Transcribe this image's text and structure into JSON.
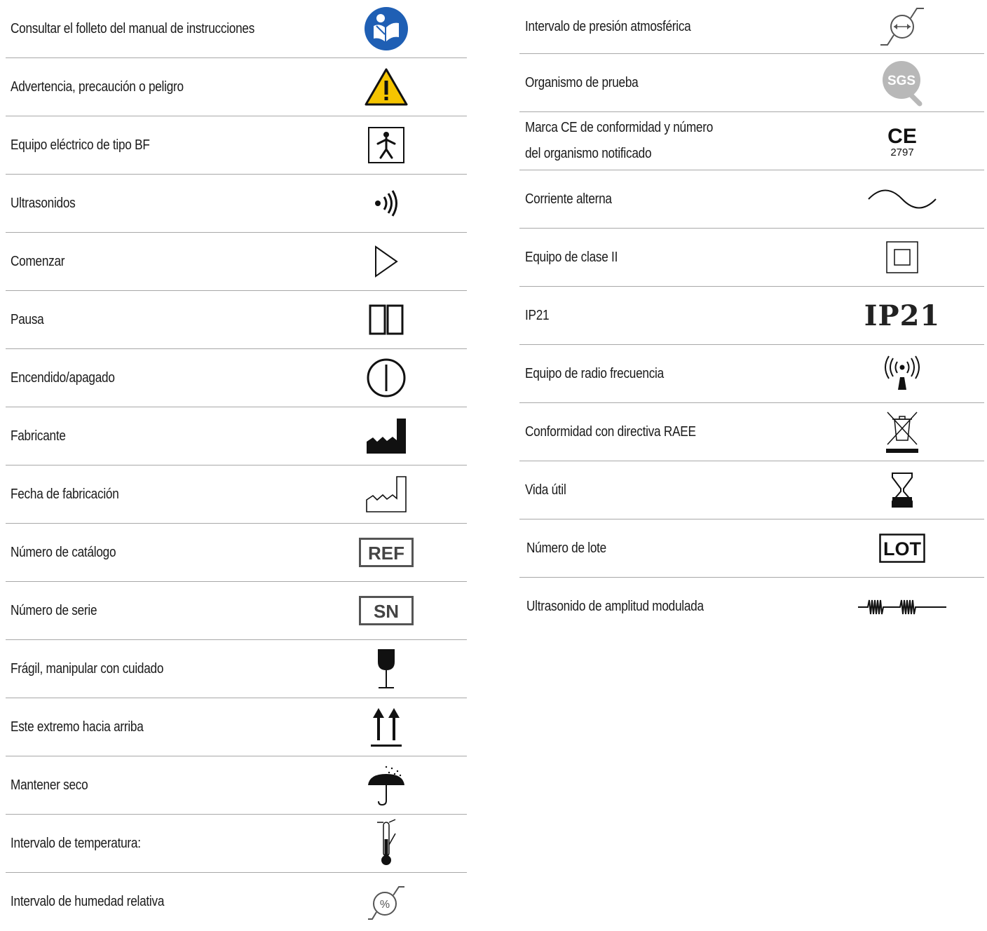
{
  "left_rows": [
    {
      "label": "Consultar el folleto del manual de instrucciones",
      "icon": "instruction-manual-icon"
    },
    {
      "label": "Advertencia, precaución o peligro",
      "icon": "warning-triangle-icon"
    },
    {
      "label": "Equipo eléctrico de tipo BF",
      "icon": "type-bf-icon"
    },
    {
      "label": "Ultrasonidos",
      "icon": "ultrasound-waves-icon"
    },
    {
      "label": "Comenzar",
      "icon": "play-icon"
    },
    {
      "label": "Pausa",
      "icon": "pause-icon"
    },
    {
      "label": "Encendido/apagado",
      "icon": "power-icon"
    },
    {
      "label": "Fabricante",
      "icon": "manufacturer-icon"
    },
    {
      "label": "Fecha de fabricación",
      "icon": "manufacture-date-icon"
    },
    {
      "label": "Número de catálogo",
      "icon": "ref-box-icon",
      "box_text": "REF"
    },
    {
      "label": "Número de serie",
      "icon": "sn-box-icon",
      "box_text": "SN"
    },
    {
      "label": "Frágil, manipular con cuidado",
      "icon": "fragile-glass-icon"
    },
    {
      "label": "Este extremo hacia arriba",
      "icon": "this-way-up-icon"
    },
    {
      "label": "Mantener seco",
      "icon": "keep-dry-umbrella-icon"
    },
    {
      "label": "Intervalo de temperatura:",
      "icon": "temperature-limit-icon"
    },
    {
      "label": "Intervalo de humedad relativa",
      "icon": "humidity-limit-icon"
    }
  ],
  "right_rows": [
    {
      "label": "Intervalo de presión atmosférica",
      "icon": "pressure-limit-icon"
    },
    {
      "label": "Organismo de prueba",
      "icon": "sgs-logo-icon",
      "logo_text": "SGS"
    },
    {
      "label_line1": "Marca CE de conformidad y número",
      "label_line2": "del organismo notificado",
      "icon": "ce-mark-icon",
      "ce_text": "CE",
      "ce_number": "2797"
    },
    {
      "label": "Corriente alterna",
      "icon": "alternating-current-icon"
    },
    {
      "label": "Equipo de clase II",
      "icon": "class-ii-icon"
    },
    {
      "label": "IP21",
      "icon": "ip21-text-icon",
      "symbol_text": "IP21"
    },
    {
      "label": "Equipo de radio frecuencia",
      "icon": "radio-frequency-icon"
    },
    {
      "label": "Conformidad con directiva RAEE",
      "icon": "weee-bin-icon"
    },
    {
      "label": "Vida útil",
      "icon": "hourglass-icon"
    },
    {
      "label": "Número de lote",
      "icon": "lot-box-icon",
      "box_text": "LOT"
    },
    {
      "label": "Ultrasonido de amplitud modulada",
      "icon": "modulated-wave-icon"
    }
  ],
  "colors": {
    "manual_blue": "#1f5fb4",
    "warning_yellow": "#f5c400",
    "divider": "#a8a8a8"
  }
}
